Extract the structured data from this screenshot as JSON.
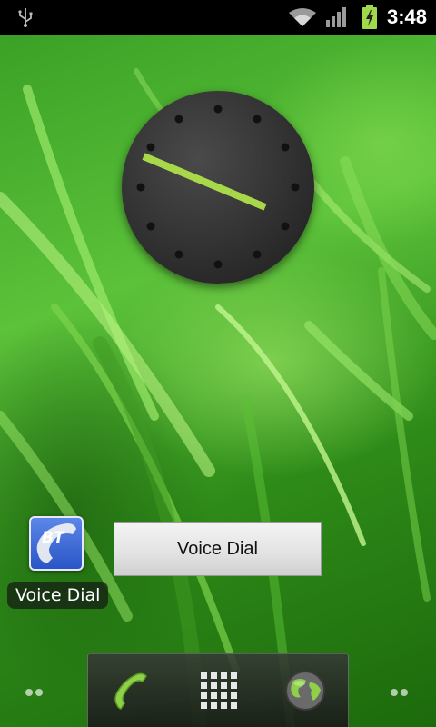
{
  "status_bar": {
    "time": "3:48",
    "icons": [
      "usb-icon",
      "wifi-icon",
      "signal-icon",
      "battery-charging-icon"
    ]
  },
  "clock_widget": {
    "type": "analog-clock",
    "time": "3:48"
  },
  "home_screen": {
    "shortcut": {
      "icon": "bluetooth-phone-icon",
      "icon_text": "BT",
      "label": "Voice Dial"
    },
    "voice_dial_widget": {
      "label": "Voice Dial"
    }
  },
  "dock": {
    "items": [
      {
        "name": "phone",
        "icon": "phone-icon"
      },
      {
        "name": "all-apps",
        "icon": "app-grid-icon"
      },
      {
        "name": "browser",
        "icon": "globe-icon"
      }
    ]
  },
  "colors": {
    "status_bar_bg": "#000000",
    "clock_hand": "#a8d84a",
    "wallpaper": "#3aa126"
  }
}
